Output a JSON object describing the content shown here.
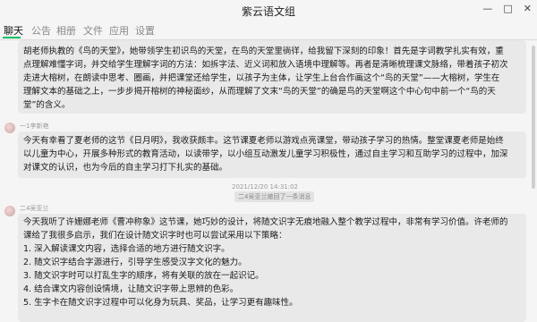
{
  "window": {
    "title": "紫云语文组"
  },
  "tabs": [
    {
      "label": "聊天"
    },
    {
      "label": "公告"
    },
    {
      "label": "相册"
    },
    {
      "label": "文件"
    },
    {
      "label": "应用"
    },
    {
      "label": "设置"
    }
  ],
  "messages": [
    {
      "lines": [
        "胡老师执教的《鸟的天堂》，她带领学生初识鸟的天堂，在鸟的天堂里徜徉，给我留下深刻的印象！首先是字词教学扎实有效，重",
        "点理解难懂字词，并交给学生理解字词的方法：如拆字法、近义词和放入语境中理解等。再者是清晰梳理课文脉络，带着孩子初次",
        "走进大榕树，在朗读中思考、圈画，并把课堂还给学生，以孩子为主体，让学生上台合作画这个“鸟的天堂”——大榕树，学生在",
        "理解文本的基础之上，一步步揭开榕树的神秘面纱，从而理解了文末“鸟的天堂”的确是鸟的天堂啊这个中心句中前一个“鸟的天",
        "堂”的含义。"
      ]
    },
    {
      "sender": "一1李新艳",
      "lines": [
        "今天有幸看了夏老师的这节《日月明》，我收获颇丰。这节课夏老师以游戏点亮课堂，带动孩子学习的热情。整堂课夏老师是始终",
        "以儿童为中心，开展多种形式的教育活动，以读带学，以小组互动激发儿童学习积极性，通过自主学习和互助学习的过程中，加深",
        "对课文的认识，也为今后的自主学习打下扎实的基础。"
      ]
    },
    {
      "sender": "二4吴亚兰",
      "lines": [
        "今天我听了许姗娜老师《曹冲称象》这节课，她巧妙的设计，将随文识字无痕地融入整个教学过程中，非常有学习价值。许老师的",
        "课给了我很多启示，我们在设计随文识字时也可以尝试采用以下策略：",
        "1. 深入解读课文内容，选择合适的地方进行随文识字。",
        "2. 随文识字结合字源进行，引导学生感受汉字文化的魅力。",
        "3. 随文识字时可以打乱生字的顺序，将有关联的放在一起识记。",
        "4. 结合课文内容创设情境，让随文识字带上思辨的色彩。",
        "5. 生字卡在随文识字过程中可以化身为玩具、奖品，让学习更有趣味性。"
      ]
    }
  ],
  "timestamp": "2021/12/20 14:31:02",
  "system_notice": "二4吴亚兰撤回了一条消息",
  "icons": {
    "minimize": "minimize-icon",
    "maximize": "maximize-icon",
    "close": "close-icon"
  }
}
